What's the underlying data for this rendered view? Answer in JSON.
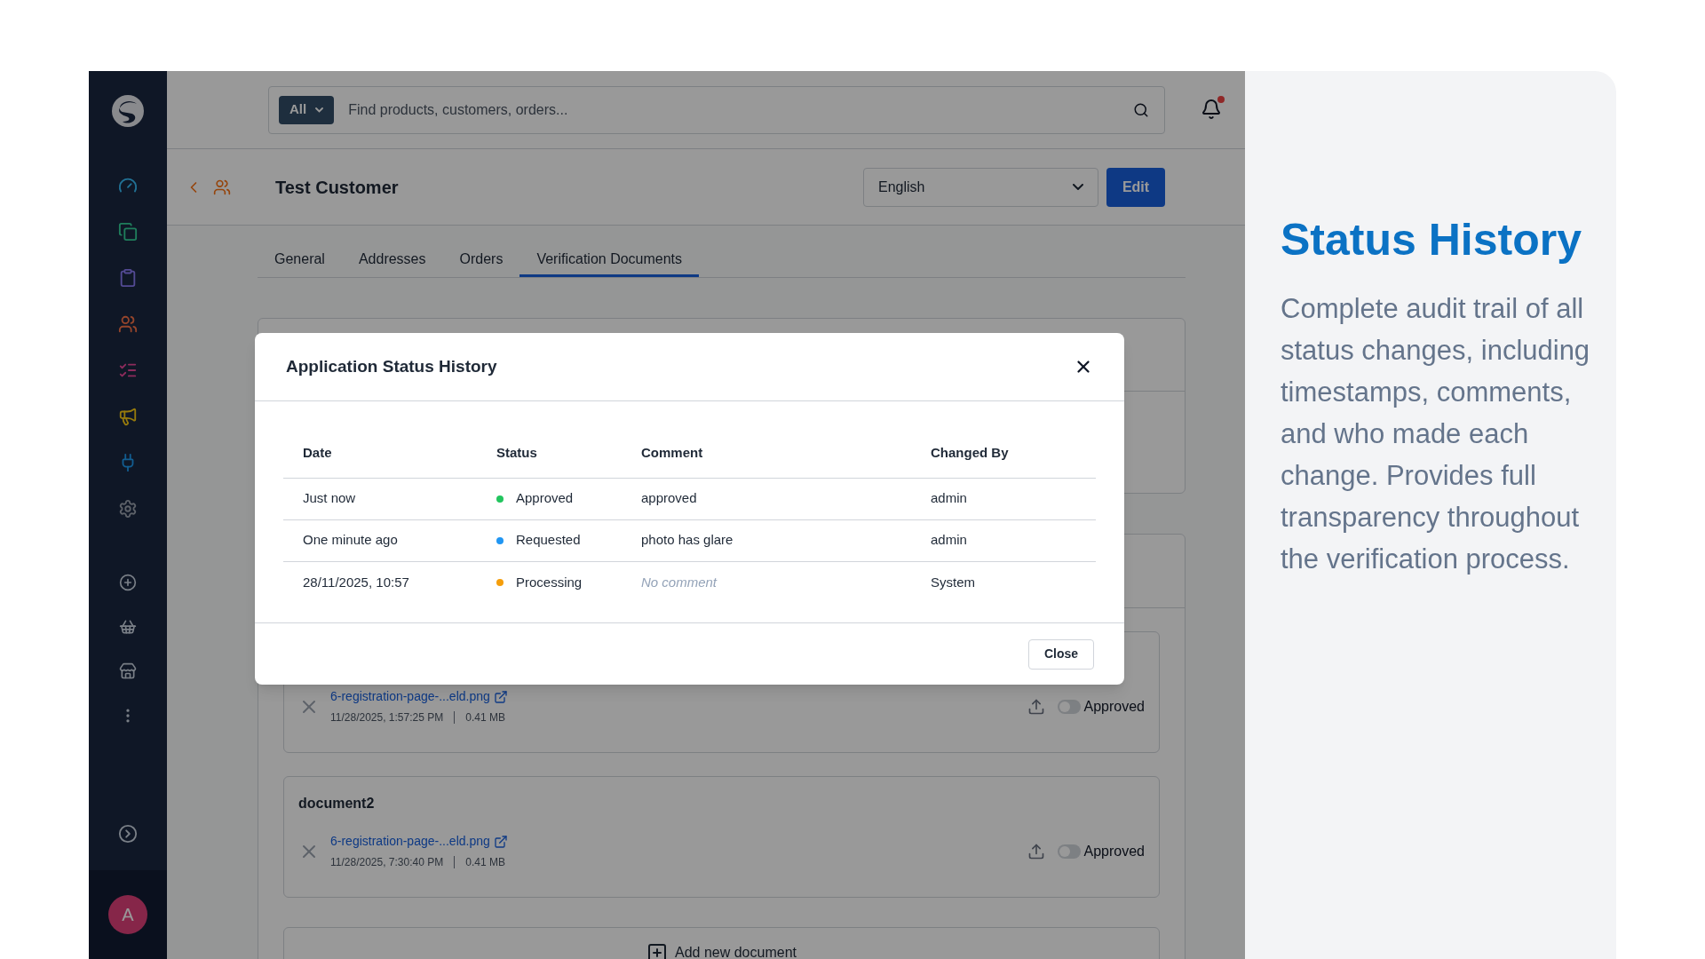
{
  "search": {
    "scope": "All",
    "placeholder": "Find products, customers, orders..."
  },
  "notifications": {
    "unread": true
  },
  "header": {
    "title": "Test Customer",
    "language": "English",
    "edit": "Edit"
  },
  "tabs": [
    {
      "label": "General",
      "selected": false
    },
    {
      "label": "Addresses",
      "selected": false
    },
    {
      "label": "Orders",
      "selected": false
    },
    {
      "label": "Verification Documents",
      "selected": true
    }
  ],
  "documents": [
    {
      "file": "6-registration-page-...eld.png",
      "date": "11/28/2025, 1:57:25 PM",
      "size": "0.41 MB",
      "status": "Approved",
      "on": false
    },
    {
      "title": "document2",
      "file": "6-registration-page-...eld.png",
      "date": "11/28/2025, 7:30:40 PM",
      "size": "0.41 MB",
      "status": "Approved",
      "on": false
    }
  ],
  "add_document": "Add new document",
  "avatar": {
    "initial": "A"
  },
  "modal": {
    "title": "Application Status History",
    "columns": [
      "Date",
      "Status",
      "Comment",
      "Changed By"
    ],
    "rows": [
      {
        "date": "Just now",
        "status": "Approved",
        "color": "#22c55e",
        "comment": "approved",
        "comment_empty": false,
        "changed_by": "admin"
      },
      {
        "date": "One minute ago",
        "status": "Requested",
        "color": "#2196f3",
        "comment": "photo has glare",
        "comment_empty": false,
        "changed_by": "admin"
      },
      {
        "date": "28/11/2025, 10:57",
        "status": "Processing",
        "color": "#f59e0b",
        "comment": "No comment",
        "comment_empty": true,
        "changed_by": "System"
      }
    ],
    "close": "Close"
  },
  "aside": {
    "title": "Status History",
    "text": "Complete audit trail of all status changes, including timestamps, comments, and who made each change. Provides full transparency throughout the verification process."
  }
}
